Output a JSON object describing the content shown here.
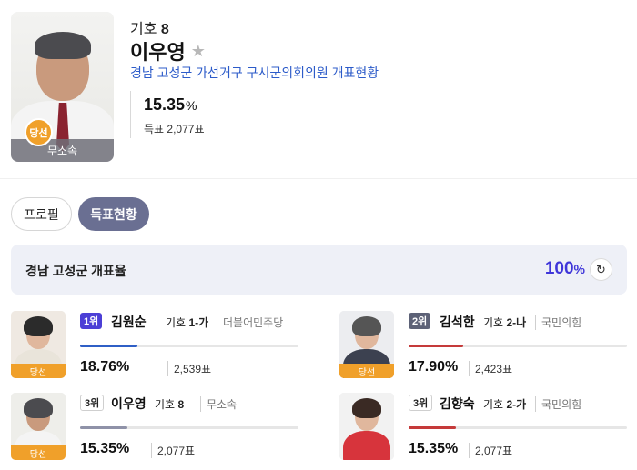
{
  "header": {
    "number_prefix": "기호",
    "number": "8",
    "name": "이우영",
    "subtitle": "경남 고성군 가선거구 구시군의회의원 개표현황",
    "percent": "15.35",
    "percent_unit": "%",
    "votes_text": "득표 2,077표",
    "party": "무소속",
    "win_badge": "당선",
    "star_icon": "star-icon"
  },
  "tabs": [
    {
      "label": "프로필",
      "active": false
    },
    {
      "label": "득표현황",
      "active": true
    }
  ],
  "rate": {
    "label": "경남 고성군 개표율",
    "value": "100",
    "unit": "%",
    "refresh_icon": "refresh-icon"
  },
  "candidates": [
    {
      "rank": "1위",
      "name": "김원순",
      "number_label": "기호",
      "number": "1-가",
      "party": "더불어민주당",
      "percent": "18.76%",
      "votes": "2,539표",
      "share": 18.76,
      "bar_color": "#2f5fc6",
      "badge": "당선"
    },
    {
      "rank": "2위",
      "name": "김석한",
      "number_label": "기호",
      "number": "2-나",
      "party": "국민의힘",
      "percent": "17.90%",
      "votes": "2,423표",
      "share": 17.9,
      "bar_color": "#c53a3a",
      "badge": "당선"
    },
    {
      "rank": "3위",
      "name": "이우영",
      "number_label": "기호",
      "number": "8",
      "party": "무소속",
      "percent": "15.35%",
      "votes": "2,077표",
      "share": 15.35,
      "bar_color": "#8f92a8",
      "badge": "당선"
    },
    {
      "rank": "3위",
      "name": "김향숙",
      "number_label": "기호",
      "number": "2-가",
      "party": "국민의힘",
      "percent": "15.35%",
      "votes": "2,077표",
      "share": 15.35,
      "bar_color": "#c53a3a",
      "badge": ""
    }
  ],
  "colors": {
    "accent": "#3f36d9",
    "win": "#f0a02a",
    "tab_active": "#6a6f92"
  }
}
